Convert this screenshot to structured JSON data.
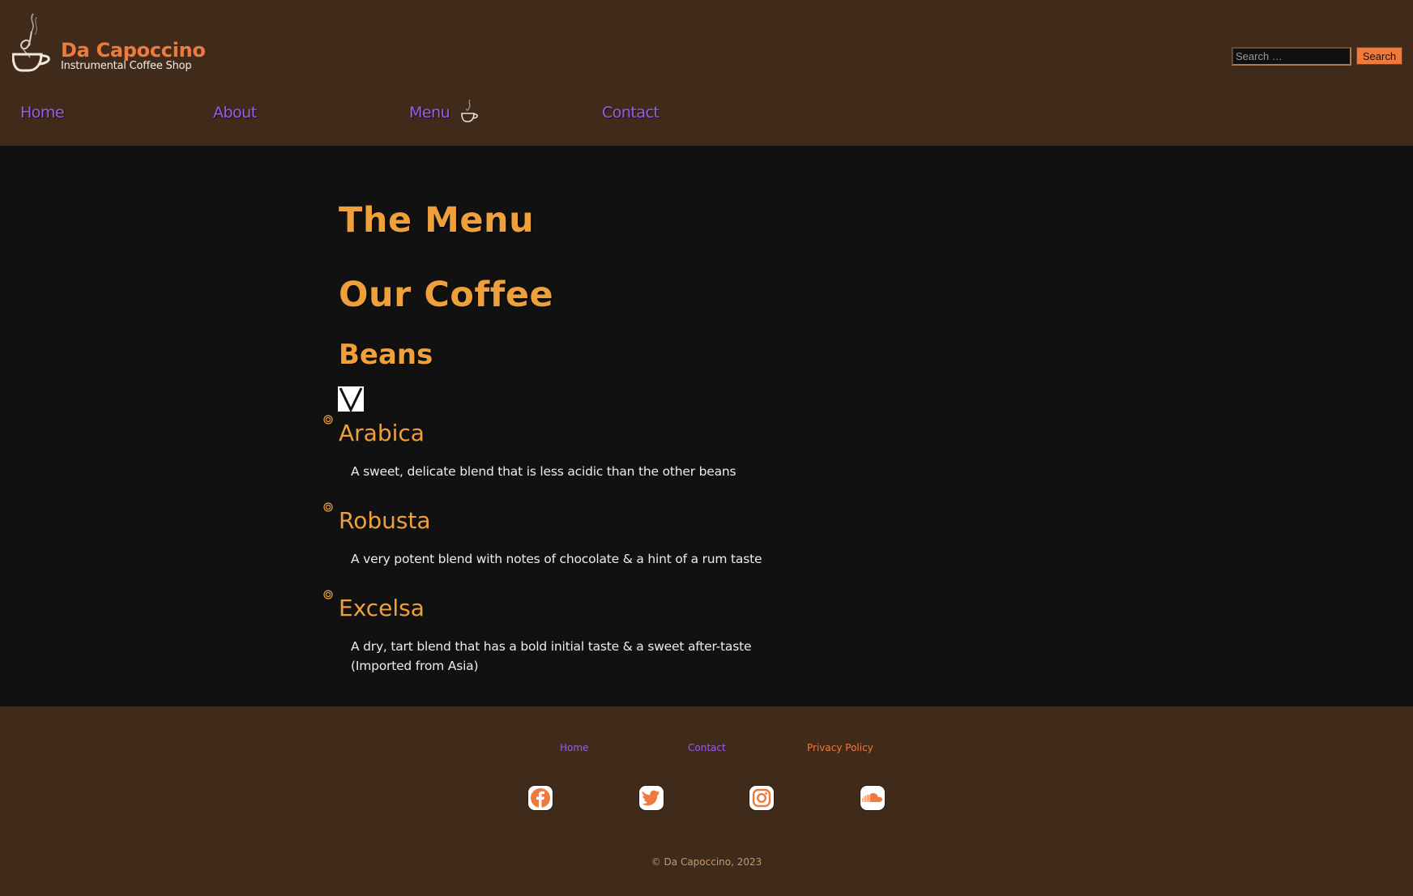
{
  "header": {
    "brand_title": "Da Capoccino",
    "brand_subtitle": "Instrumental Coffee Shop",
    "logo_icon": "coffee-cup-steam-icon",
    "search": {
      "placeholder": "Search …",
      "value": "",
      "button_label": "Search"
    },
    "nav": [
      {
        "label": "Home"
      },
      {
        "label": "About"
      },
      {
        "label": "Menu",
        "current": true,
        "icon": "coffee-cup-icon"
      },
      {
        "label": "Contact"
      }
    ]
  },
  "main": {
    "title": "The Menu",
    "section_title": "Our Coffee",
    "subsection_title": "Beans",
    "badge_icon": "vegan-v-icon",
    "beans": [
      {
        "name": "Arabica",
        "description": "A sweet, delicate blend that is less acidic than the other beans"
      },
      {
        "name": "Robusta",
        "description": "A very potent blend with notes of chocolate & a hint of a rum taste"
      },
      {
        "name": "Excelsa",
        "description": "A dry, tart blend that has a bold initial taste & a sweet after-taste (Imported from Asia)"
      }
    ]
  },
  "footer": {
    "links": [
      {
        "label": "Home"
      },
      {
        "label": "Contact"
      },
      {
        "label": "Privacy Policy"
      }
    ],
    "social": [
      {
        "name": "facebook-icon"
      },
      {
        "name": "twitter-icon"
      },
      {
        "name": "instagram-icon"
      },
      {
        "name": "soundcloud-icon"
      }
    ],
    "copyright": "© Da Capoccino, 2023"
  },
  "colors": {
    "header_bg": "#402b1b",
    "main_bg": "#111111",
    "brand_orange": "#ef7a3e",
    "heading_orange": "#f0a03a",
    "link_purple": "#9b5de5",
    "copyright_tan": "#c49a6c"
  }
}
